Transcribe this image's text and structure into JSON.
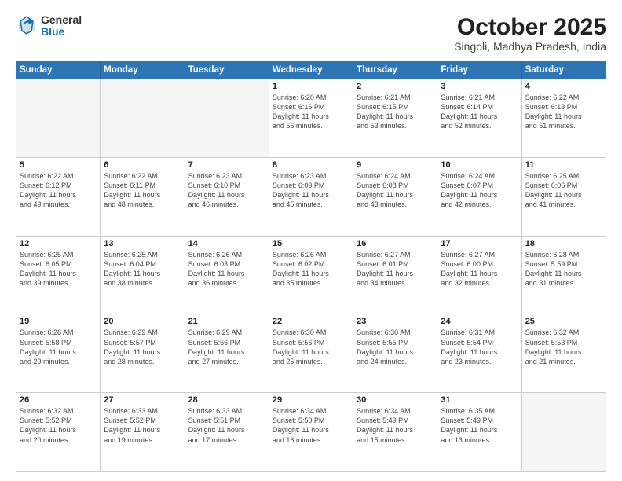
{
  "logo": {
    "general": "General",
    "blue": "Blue"
  },
  "header": {
    "month": "October 2025",
    "location": "Singoli, Madhya Pradesh, India"
  },
  "weekdays": [
    "Sunday",
    "Monday",
    "Tuesday",
    "Wednesday",
    "Thursday",
    "Friday",
    "Saturday"
  ],
  "weeks": [
    [
      {
        "day": "",
        "info": ""
      },
      {
        "day": "",
        "info": ""
      },
      {
        "day": "",
        "info": ""
      },
      {
        "day": "1",
        "info": "Sunrise: 6:20 AM\nSunset: 6:16 PM\nDaylight: 11 hours\nand 55 minutes."
      },
      {
        "day": "2",
        "info": "Sunrise: 6:21 AM\nSunset: 6:15 PM\nDaylight: 11 hours\nand 53 minutes."
      },
      {
        "day": "3",
        "info": "Sunrise: 6:21 AM\nSunset: 6:14 PM\nDaylight: 11 hours\nand 52 minutes."
      },
      {
        "day": "4",
        "info": "Sunrise: 6:22 AM\nSunset: 6:13 PM\nDaylight: 11 hours\nand 51 minutes."
      }
    ],
    [
      {
        "day": "5",
        "info": "Sunrise: 6:22 AM\nSunset: 6:12 PM\nDaylight: 11 hours\nand 49 minutes."
      },
      {
        "day": "6",
        "info": "Sunrise: 6:22 AM\nSunset: 6:11 PM\nDaylight: 11 hours\nand 48 minutes."
      },
      {
        "day": "7",
        "info": "Sunrise: 6:23 AM\nSunset: 6:10 PM\nDaylight: 11 hours\nand 46 minutes."
      },
      {
        "day": "8",
        "info": "Sunrise: 6:23 AM\nSunset: 6:09 PM\nDaylight: 11 hours\nand 45 minutes."
      },
      {
        "day": "9",
        "info": "Sunrise: 6:24 AM\nSunset: 6:08 PM\nDaylight: 11 hours\nand 43 minutes."
      },
      {
        "day": "10",
        "info": "Sunrise: 6:24 AM\nSunset: 6:07 PM\nDaylight: 11 hours\nand 42 minutes."
      },
      {
        "day": "11",
        "info": "Sunrise: 6:25 AM\nSunset: 6:06 PM\nDaylight: 11 hours\nand 41 minutes."
      }
    ],
    [
      {
        "day": "12",
        "info": "Sunrise: 6:25 AM\nSunset: 6:05 PM\nDaylight: 11 hours\nand 39 minutes."
      },
      {
        "day": "13",
        "info": "Sunrise: 6:25 AM\nSunset: 6:04 PM\nDaylight: 11 hours\nand 38 minutes."
      },
      {
        "day": "14",
        "info": "Sunrise: 6:26 AM\nSunset: 6:03 PM\nDaylight: 11 hours\nand 36 minutes."
      },
      {
        "day": "15",
        "info": "Sunrise: 6:26 AM\nSunset: 6:02 PM\nDaylight: 11 hours\nand 35 minutes."
      },
      {
        "day": "16",
        "info": "Sunrise: 6:27 AM\nSunset: 6:01 PM\nDaylight: 11 hours\nand 34 minutes."
      },
      {
        "day": "17",
        "info": "Sunrise: 6:27 AM\nSunset: 6:00 PM\nDaylight: 11 hours\nand 32 minutes."
      },
      {
        "day": "18",
        "info": "Sunrise: 6:28 AM\nSunset: 5:59 PM\nDaylight: 11 hours\nand 31 minutes."
      }
    ],
    [
      {
        "day": "19",
        "info": "Sunrise: 6:28 AM\nSunset: 5:58 PM\nDaylight: 11 hours\nand 29 minutes."
      },
      {
        "day": "20",
        "info": "Sunrise: 6:29 AM\nSunset: 5:57 PM\nDaylight: 11 hours\nand 28 minutes."
      },
      {
        "day": "21",
        "info": "Sunrise: 6:29 AM\nSunset: 5:56 PM\nDaylight: 11 hours\nand 27 minutes."
      },
      {
        "day": "22",
        "info": "Sunrise: 6:30 AM\nSunset: 5:56 PM\nDaylight: 11 hours\nand 25 minutes."
      },
      {
        "day": "23",
        "info": "Sunrise: 6:30 AM\nSunset: 5:55 PM\nDaylight: 11 hours\nand 24 minutes."
      },
      {
        "day": "24",
        "info": "Sunrise: 6:31 AM\nSunset: 5:54 PM\nDaylight: 11 hours\nand 23 minutes."
      },
      {
        "day": "25",
        "info": "Sunrise: 6:32 AM\nSunset: 5:53 PM\nDaylight: 11 hours\nand 21 minutes."
      }
    ],
    [
      {
        "day": "26",
        "info": "Sunrise: 6:32 AM\nSunset: 5:52 PM\nDaylight: 11 hours\nand 20 minutes."
      },
      {
        "day": "27",
        "info": "Sunrise: 6:33 AM\nSunset: 5:52 PM\nDaylight: 11 hours\nand 19 minutes."
      },
      {
        "day": "28",
        "info": "Sunrise: 6:33 AM\nSunset: 5:51 PM\nDaylight: 11 hours\nand 17 minutes."
      },
      {
        "day": "29",
        "info": "Sunrise: 6:34 AM\nSunset: 5:50 PM\nDaylight: 11 hours\nand 16 minutes."
      },
      {
        "day": "30",
        "info": "Sunrise: 6:34 AM\nSunset: 5:49 PM\nDaylight: 11 hours\nand 15 minutes."
      },
      {
        "day": "31",
        "info": "Sunrise: 6:35 AM\nSunset: 5:49 PM\nDaylight: 11 hours\nand 13 minutes."
      },
      {
        "day": "",
        "info": ""
      }
    ]
  ]
}
